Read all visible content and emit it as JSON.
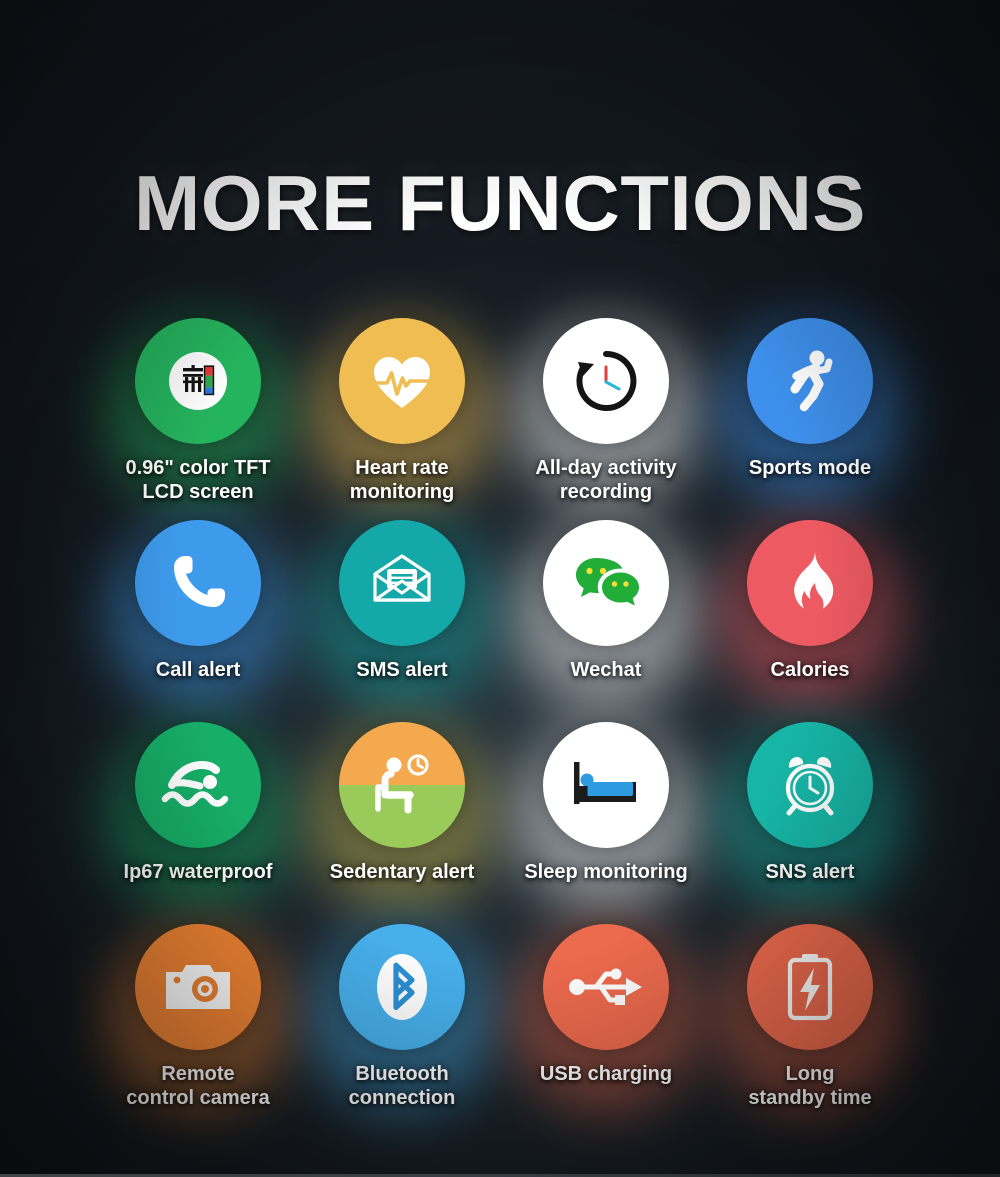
{
  "header": {
    "title": "MORE FUNCTIONS"
  },
  "theme": {
    "background": "#13191f",
    "text": "#ffffff"
  },
  "features": [
    {
      "id": "tft-screen",
      "label": "0.96\" color TFT\nLCD screen",
      "icon": "color-screen-icon",
      "circle_color": "#25B45E",
      "glow_color": "#25B45E",
      "icon_color": "#111111",
      "accent_colors": [
        "#E53935",
        "#2EA84F",
        "#2979E8"
      ]
    },
    {
      "id": "heart-rate",
      "label": "Heart rate\nmonitoring",
      "icon": "heart-pulse-icon",
      "circle_color": "#EFBD52",
      "glow_color": "#EFBD52",
      "icon_color": "#FFFFFF"
    },
    {
      "id": "activity-recording",
      "label": "All-day activity\nrecording",
      "icon": "clock-history-icon",
      "circle_color": "#FFFFFF",
      "glow_color": "#FFFFFF",
      "icon_color": "#111111",
      "accent_colors": [
        "#E0403A",
        "#2BB8D6"
      ]
    },
    {
      "id": "sports-mode",
      "label": "Sports mode",
      "icon": "running-person-icon",
      "circle_color": "#3E90EC",
      "glow_color": "#3E90EC",
      "icon_color": "#FFFFFF"
    },
    {
      "id": "call-alert",
      "label": "Call alert",
      "icon": "phone-handset-icon",
      "circle_color": "#3E9BEC",
      "glow_color": "#3E9BEC",
      "icon_color": "#FFFFFF"
    },
    {
      "id": "sms-alert",
      "label": "SMS alert",
      "icon": "envelope-message-icon",
      "circle_color": "#14A9A8",
      "glow_color": "#14A9A8",
      "icon_color": "#FFFFFF"
    },
    {
      "id": "wechat",
      "label": "Wechat",
      "icon": "wechat-bubbles-icon",
      "circle_color": "#FFFFFF",
      "glow_color": "#FFFFFF",
      "icon_color": "#22AC38",
      "accent_colors": [
        "#F5E03A"
      ]
    },
    {
      "id": "calories",
      "label": "Calories",
      "icon": "flame-icon",
      "circle_color": "#EE5A62",
      "glow_color": "#EE5A62",
      "icon_color": "#FFFFFF"
    },
    {
      "id": "waterproof",
      "label": "Ip67 waterproof",
      "icon": "swimmer-icon",
      "circle_color": "#17AE68",
      "glow_color": "#17AE68",
      "icon_color": "#FFFFFF"
    },
    {
      "id": "sedentary-alert",
      "label": "Sedentary alert",
      "icon": "sitting-person-clock-icon",
      "circle_color": "#F5A94E",
      "circle_color_bottom": "#9ACB5A",
      "glow_color": "#C9B94E",
      "icon_color": "#FFFFFF"
    },
    {
      "id": "sleep-monitoring",
      "label": "Sleep monitoring",
      "icon": "bed-sleep-icon",
      "circle_color": "#FFFFFF",
      "glow_color": "#FFFFFF",
      "icon_color": "#1B1B1B",
      "accent_colors": [
        "#2E9BE0"
      ]
    },
    {
      "id": "sns-alert",
      "label": "SNS alert",
      "icon": "alarm-clock-icon",
      "circle_color": "#17B5A6",
      "glow_color": "#17B5A6",
      "icon_color": "#FFFFFF"
    },
    {
      "id": "remote-camera",
      "label": "Remote\ncontrol camera",
      "icon": "camera-icon",
      "circle_color": "#EF8434",
      "glow_color": "#EF8434",
      "icon_color": "#FFFFFF"
    },
    {
      "id": "bluetooth",
      "label": "Bluetooth\nconnection",
      "icon": "bluetooth-icon",
      "circle_color": "#47AFEA",
      "glow_color": "#47AFEA",
      "icon_color": "#2C8FD4",
      "accent_colors": [
        "#FFFFFF"
      ]
    },
    {
      "id": "usb-charging",
      "label": "USB charging",
      "icon": "usb-icon",
      "circle_color": "#EC6A4D",
      "glow_color": "#EC6A4D",
      "icon_color": "#FFFFFF"
    },
    {
      "id": "long-standby",
      "label": "Long\nstandby time",
      "icon": "battery-bolt-icon",
      "circle_color": "#EC6A4D",
      "glow_color": "#EC6A4D",
      "icon_color": "#FFFFFF"
    }
  ]
}
